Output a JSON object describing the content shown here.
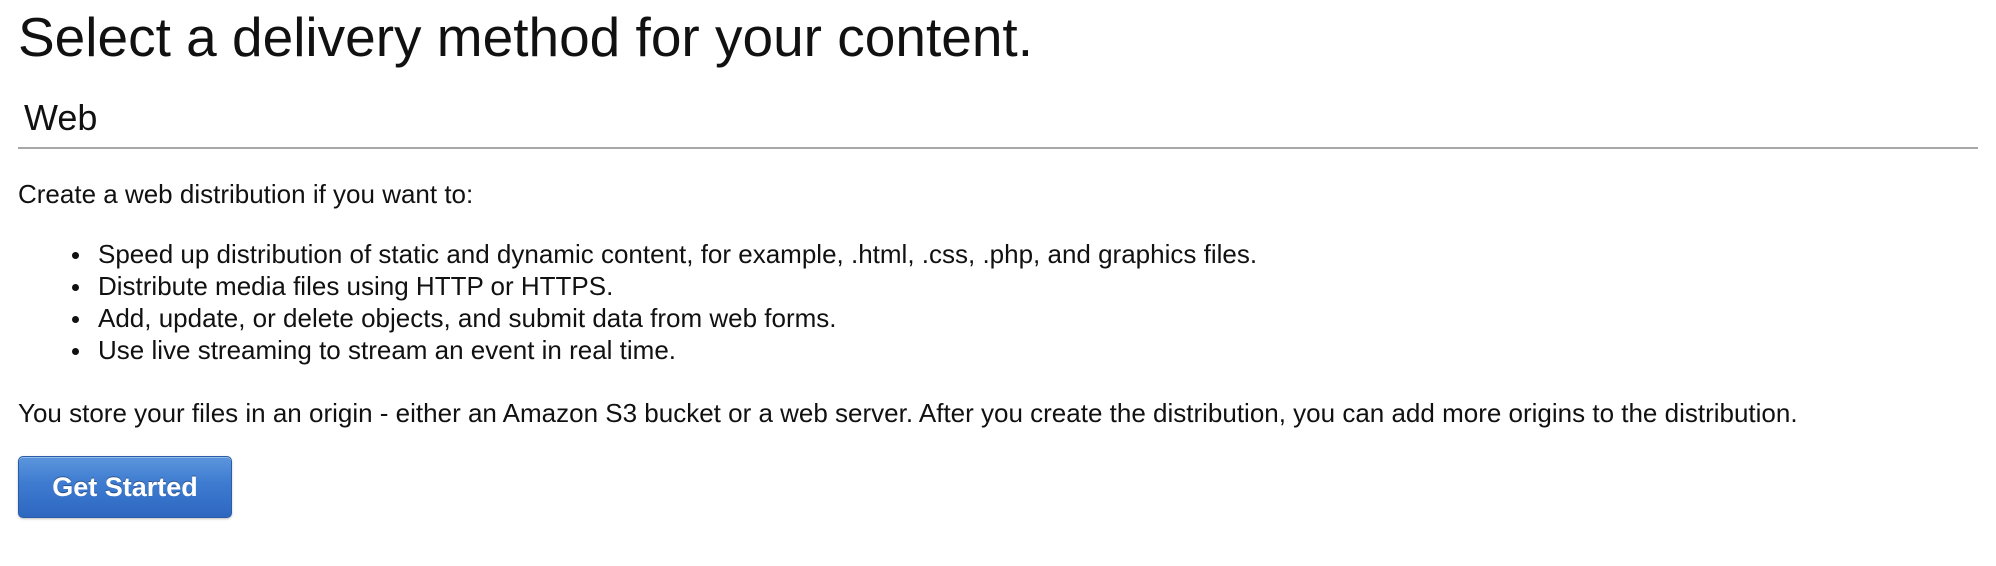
{
  "page": {
    "title": "Select a delivery method for your content."
  },
  "web_section": {
    "heading": "Web",
    "intro": "Create a web distribution if you want to:",
    "features": [
      "Speed up distribution of static and dynamic content, for example, .html, .css, .php, and graphics files.",
      "Distribute media files using HTTP or HTTPS.",
      "Add, update, or delete objects, and submit data from web forms.",
      "Use live streaming to stream an event in real time."
    ],
    "origin_note": "You store your files in an origin - either an Amazon S3 bucket or a web server. After you create the distribution, you can add more origins to the distribution.",
    "button_label": "Get Started"
  },
  "colors": {
    "button_blue": "#3d7bd0",
    "divider_gray": "#a8a8a8",
    "text": "#111111"
  }
}
